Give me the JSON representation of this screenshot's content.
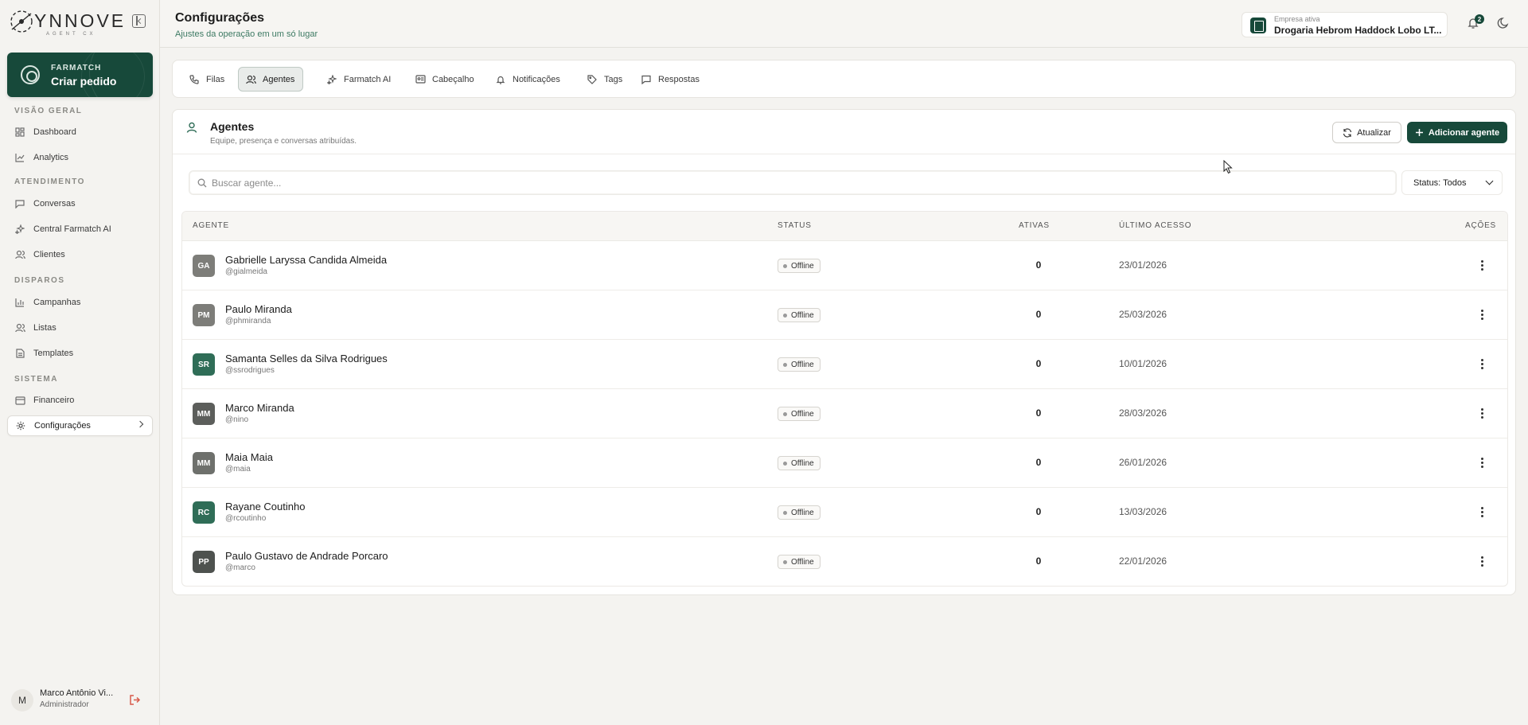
{
  "brand": {
    "name": "YNNOVE",
    "sub": "AGENT CX"
  },
  "sidebar": {
    "cta": {
      "kicker": "FARMATCH",
      "title": "Criar pedido"
    },
    "sections": [
      {
        "label": "VISÃO GERAL"
      },
      {
        "label": "ATENDIMENTO"
      },
      {
        "label": "DISPAROS"
      },
      {
        "label": "SISTEMA"
      }
    ],
    "items": [
      {
        "label": "Dashboard",
        "icon": "dashboard-icon"
      },
      {
        "label": "Analytics",
        "icon": "analytics-icon"
      },
      {
        "label": "Conversas",
        "icon": "chat-icon"
      },
      {
        "label": "Central Farmatch AI",
        "icon": "sparkle-icon"
      },
      {
        "label": "Clientes",
        "icon": "users-icon"
      },
      {
        "label": "Campanhas",
        "icon": "bar-chart-icon"
      },
      {
        "label": "Listas",
        "icon": "users-icon"
      },
      {
        "label": "Templates",
        "icon": "document-icon"
      },
      {
        "label": "Financeiro",
        "icon": "credit-card-icon"
      },
      {
        "label": "Configurações",
        "icon": "gear-icon",
        "active": true
      }
    ],
    "user": {
      "initial": "M",
      "name": "Marco Antônio Vi...",
      "role": "Administrador"
    }
  },
  "header": {
    "title": "Configurações",
    "subtitle": "Ajustes da operação em um só lugar",
    "company_kicker": "Empresa ativa",
    "company_name": "Drogaria Hebrom Haddock Lobo LT...",
    "notifications": "2"
  },
  "tabs": [
    {
      "label": "Filas",
      "icon": "phone-icon"
    },
    {
      "label": "Agentes",
      "icon": "users-icon",
      "active": true
    },
    {
      "label": "Farmatch AI",
      "icon": "sparkle-icon"
    },
    {
      "label": "Cabeçalho",
      "icon": "id-card-icon"
    },
    {
      "label": "Notificações",
      "icon": "bell-icon"
    },
    {
      "label": "Tags",
      "icon": "tag-icon"
    },
    {
      "label": "Respostas",
      "icon": "message-icon"
    }
  ],
  "agents_section": {
    "title": "Agentes",
    "subtitle": "Equipe, presença e conversas atribuídas.",
    "refresh_label": "Atualizar",
    "add_label": "Adicionar agente",
    "search_placeholder": "Buscar agente...",
    "status_filter": "Status: Todos"
  },
  "table": {
    "columns": [
      "AGENTE",
      "STATUS",
      "ATIVAS",
      "ÚLTIMO ACESSO",
      "AÇÕES"
    ],
    "rows": [
      {
        "initials": "GA",
        "color": "#7d7d79",
        "name": "Gabrielle Laryssa Candida Almeida",
        "handle": "@gialmeida",
        "status": "Offline",
        "ativas": "0",
        "ultimo": "23/01/2026"
      },
      {
        "initials": "PM",
        "color": "#7d7d79",
        "name": "Paulo Miranda",
        "handle": "@phmiranda",
        "status": "Offline",
        "ativas": "0",
        "ultimo": "25/03/2026"
      },
      {
        "initials": "SR",
        "color": "#2f6d57",
        "name": "Samanta Selles da Silva Rodrigues",
        "handle": "@ssrodrigues",
        "status": "Offline",
        "ativas": "0",
        "ultimo": "10/01/2026"
      },
      {
        "initials": "MM",
        "color": "#5c5e5b",
        "name": "Marco Miranda",
        "handle": "@nino",
        "status": "Offline",
        "ativas": "0",
        "ultimo": "28/03/2026"
      },
      {
        "initials": "MM",
        "color": "#6e706c",
        "name": "Maia Maia",
        "handle": "@maia",
        "status": "Offline",
        "ativas": "0",
        "ultimo": "26/01/2026"
      },
      {
        "initials": "RC",
        "color": "#2f6d57",
        "name": "Rayane Coutinho",
        "handle": "@rcoutinho",
        "status": "Offline",
        "ativas": "0",
        "ultimo": "13/03/2026"
      },
      {
        "initials": "PP",
        "color": "#4e524f",
        "name": "Paulo Gustavo de Andrade Porcaro",
        "handle": "@marco",
        "status": "Offline",
        "ativas": "0",
        "ultimo": "22/01/2026"
      }
    ]
  },
  "colors": {
    "brand": "#17493a",
    "accent": "#3d7a63",
    "logout": "#d85a4a"
  }
}
